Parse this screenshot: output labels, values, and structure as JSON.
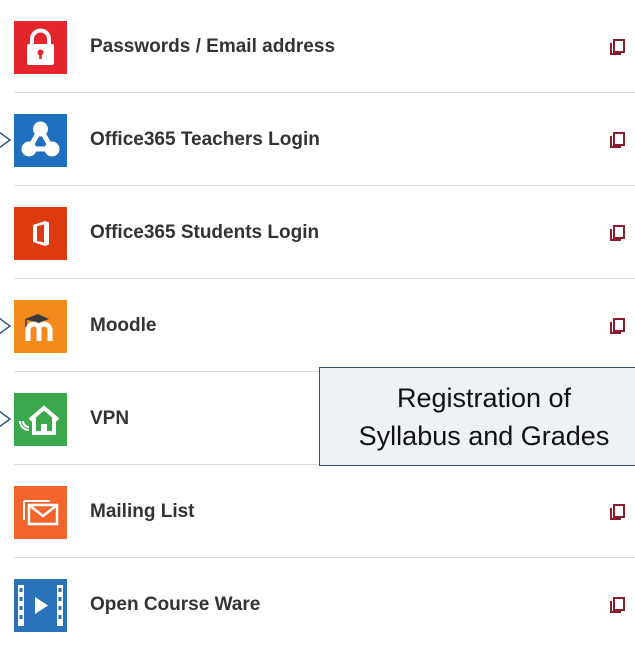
{
  "links": [
    {
      "label": "Passwords / Email address",
      "icon": "lock-icon",
      "color": "#e3262c",
      "pointer": false
    },
    {
      "label": "Office365 Teachers Login",
      "icon": "sharepoint-icon",
      "color": "#1e6fbd",
      "pointer": true
    },
    {
      "label": "Office365 Students Login",
      "icon": "office-icon",
      "color": "#dd3b0f",
      "pointer": false
    },
    {
      "label": "Moodle",
      "icon": "moodle-icon",
      "color": "#f28b1c",
      "pointer": true
    },
    {
      "label": "VPN",
      "icon": "vpn-home-icon",
      "color": "#3ca84c",
      "pointer": true
    },
    {
      "label": "Mailing List",
      "icon": "mail-icon",
      "color": "#f2642b",
      "pointer": false
    },
    {
      "label": "Open Course Ware",
      "icon": "film-play-icon",
      "color": "#2a73b9",
      "pointer": false
    }
  ],
  "callout": {
    "line1": "Registration of",
    "line2": "Syllabus and Grades"
  },
  "colors": {
    "external_link_icon": "#8a1c2b",
    "pointer_outline": "#2b4f8a",
    "callout_border": "#3b4f73",
    "callout_bg": "#eef1f6"
  }
}
